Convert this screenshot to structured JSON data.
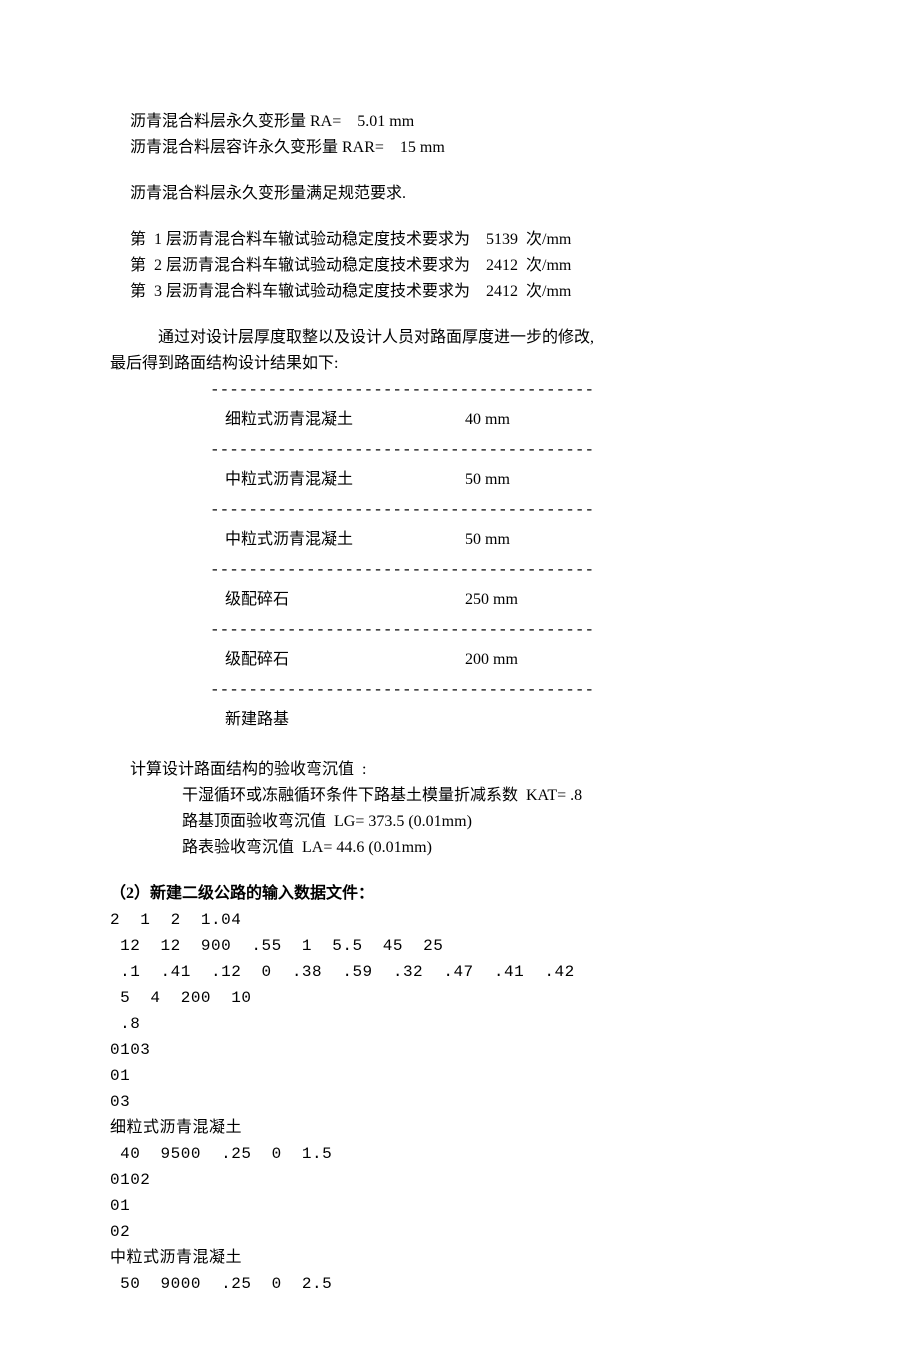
{
  "deform": {
    "ra_label": "沥青混合料层永久变形量 RA=    5.01 mm",
    "rar_label": "沥青混合料层容许永久变形量 RAR=    15 mm",
    "satisfy": "沥青混合料层永久变形量满足规范要求."
  },
  "rutting": {
    "r1": "第  1 层沥青混合料车辙试验动稳定度技术要求为    5139  次/mm",
    "r2": "第  2 层沥青混合料车辙试验动稳定度技术要求为    2412  次/mm",
    "r3": "第  3 层沥青混合料车辙试验动稳定度技术要求为    2412  次/mm"
  },
  "design_intro": {
    "l1": "通过对设计层厚度取整以及设计人员对路面厚度进一步的修改,",
    "l2": "最后得到路面结构设计结果如下:"
  },
  "divider": "----------------------------------------",
  "layers": [
    {
      "name": "细粒式沥青混凝土",
      "thk": "40 mm"
    },
    {
      "name": "中粒式沥青混凝土",
      "thk": "50 mm"
    },
    {
      "name": "中粒式沥青混凝土",
      "thk": "50 mm"
    },
    {
      "name": "级配碎石",
      "thk": "250 mm"
    },
    {
      "name": "级配碎石",
      "thk": "200 mm"
    },
    {
      "name": "新建路基",
      "thk": ""
    }
  ],
  "deflection": {
    "title": "计算设计路面结构的验收弯沉值  :",
    "kat": "干湿循环或冻融循环条件下路基土模量折减系数  KAT= .8",
    "lg": "路基顶面验收弯沉值  LG= 373.5 (0.01mm)",
    "la": "路表验收弯沉值  LA= 44.6 (0.01mm)"
  },
  "section2": {
    "title": "（2）新建二级公路的输入数据文件：",
    "lines": [
      "2  1  2  1.04",
      " 12  12  900  .55  1  5.5  45  25",
      " .1  .41  .12  0  .38  .59  .32  .47  .41  .42",
      " 5  4  200  10",
      " .8",
      "0103",
      "01",
      "03",
      "细粒式沥青混凝土",
      " 40  9500  .25  0  1.5",
      "0102",
      "01",
      "02",
      "中粒式沥青混凝土",
      " 50  9000  .25  0  2.5"
    ]
  }
}
